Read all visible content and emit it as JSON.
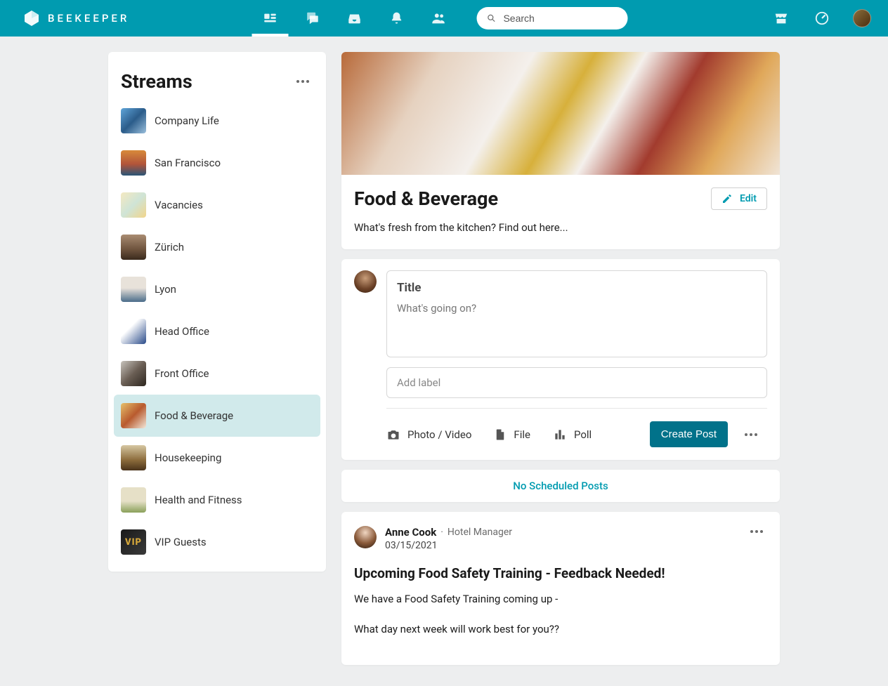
{
  "app": {
    "name": "BEEKEEPER",
    "search_placeholder": "Search"
  },
  "sidebar": {
    "title": "Streams",
    "items": [
      {
        "label": "Company Life",
        "thumb_css": "linear-gradient(135deg,#5fa5d9,#2b5c8a,#9abfdc)"
      },
      {
        "label": "San Francisco",
        "thumb_css": "linear-gradient(180deg,#d88a3a,#b1543a 55%,#2a5577)"
      },
      {
        "label": "Vacancies",
        "thumb_css": "linear-gradient(135deg,#f4e9c1,#cfe4d6,#f2d58a)"
      },
      {
        "label": "Zürich",
        "thumb_css": "linear-gradient(180deg,#a98c72,#6d523c 60%,#3a2a1d)"
      },
      {
        "label": "Lyon",
        "thumb_css": "linear-gradient(180deg,#e8e2da 45%,#4a6c8a)"
      },
      {
        "label": "Head Office",
        "thumb_css": "linear-gradient(135deg,#ffffff 35%,#2a4b8a)"
      },
      {
        "label": "Front Office",
        "thumb_css": "linear-gradient(135deg,#c7c3bc,#6a5e54,#2e2720)"
      },
      {
        "label": "Food & Beverage",
        "thumb_css": "linear-gradient(135deg,#e6c06a,#b85a2e,#f2e8da)"
      },
      {
        "label": "Housekeeping",
        "thumb_css": "linear-gradient(180deg,#d6c7a2,#8a6a3a 60%,#4a321a)"
      },
      {
        "label": "Health and Fitness",
        "thumb_css": "linear-gradient(180deg,#e6e0c7 55%,#8aa05a)"
      },
      {
        "label": "VIP Guests",
        "thumb_css": "linear-gradient(135deg,#1a1a1a,#3a3a3a)"
      }
    ],
    "active_index": 7
  },
  "stream": {
    "name": "Food & Beverage",
    "desc": "What's fresh from the kitchen? Find out here...",
    "edit_label": "Edit"
  },
  "composer": {
    "title_placeholder": "Title",
    "body_placeholder": "What's going on?",
    "label_placeholder": "Add label",
    "attach_photo": "Photo / Video",
    "attach_file": "File",
    "attach_poll": "Poll",
    "create_post": "Create Post"
  },
  "scheduled": {
    "message": "No Scheduled Posts"
  },
  "post": {
    "author": "Anne Cook",
    "role": "Hotel Manager",
    "date": "03/15/2021",
    "title": "Upcoming Food Safety Training - Feedback Needed!",
    "body_line1": "We have a Food Safety Training coming up -",
    "body_line2": "What day next week will work best for you??"
  }
}
